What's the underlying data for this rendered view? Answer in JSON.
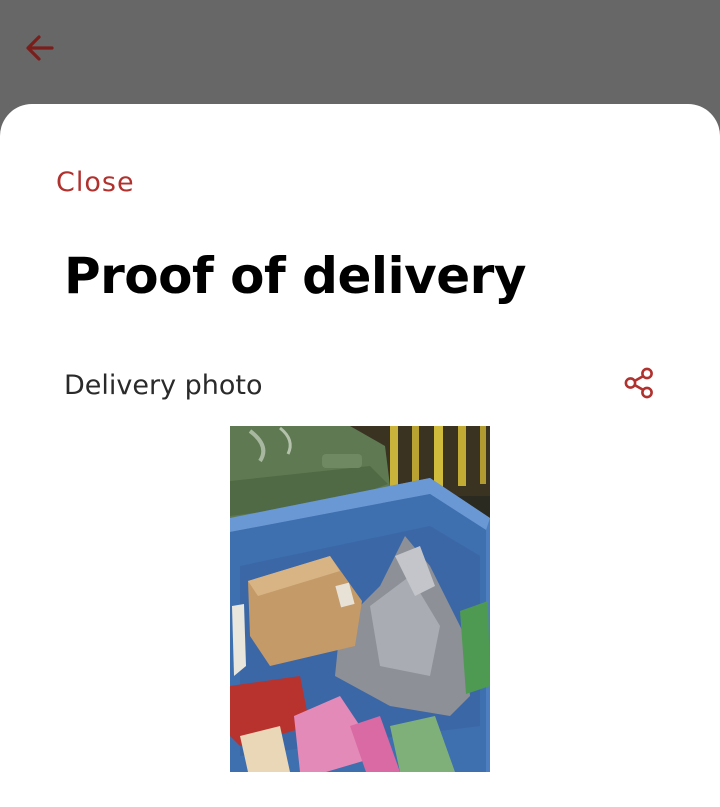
{
  "header": {
    "back_icon": "arrow-left-icon"
  },
  "sheet": {
    "close_label": "Close",
    "title": "Proof of delivery",
    "section_label": "Delivery photo",
    "share_icon": "share-icon"
  },
  "photo": {
    "subject": "parcel-in-recycling-bin-photo"
  },
  "colors": {
    "accent": "#b0322f",
    "back_arrow": "#7a1e1c",
    "scrim": "#676767",
    "sheet_bg": "#ffffff",
    "title_text": "#000000",
    "label_text": "#2a2a2a"
  }
}
